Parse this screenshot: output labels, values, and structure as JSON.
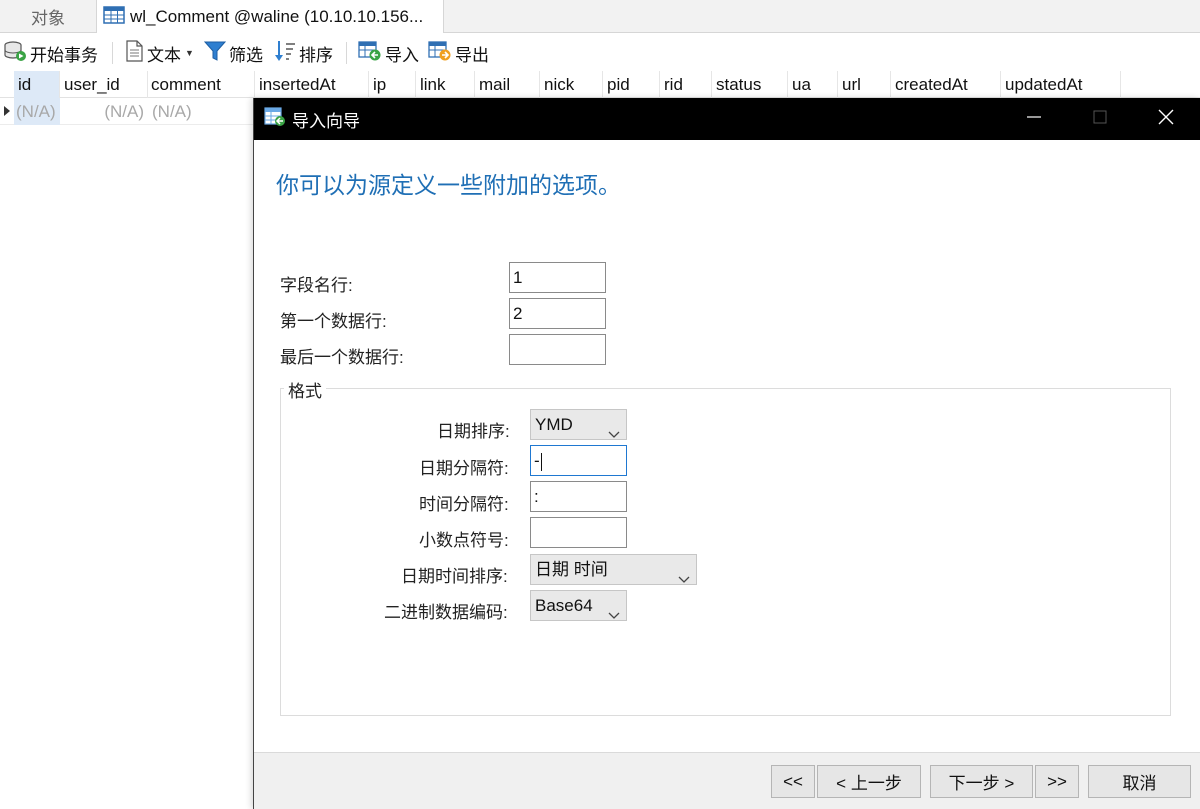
{
  "tabs": {
    "objects_label": "对象",
    "table_label": "wl_Comment @waline (10.10.10.156..."
  },
  "toolbar": {
    "begin_transaction": "开始事务",
    "text": "文本",
    "filter": "筛选",
    "sort": "排序",
    "import": "导入",
    "export": "导出"
  },
  "grid": {
    "columns": [
      "id",
      "user_id",
      "comment",
      "insertedAt",
      "ip",
      "link",
      "mail",
      "nick",
      "pid",
      "rid",
      "status",
      "ua",
      "url",
      "createdAt",
      "updatedAt"
    ],
    "row": [
      "(N/A)",
      "(N/A)",
      "(N/A)"
    ]
  },
  "dialog": {
    "title": "导入向导",
    "heading": "你可以为源定义一些附加的选项。",
    "field_name_row": {
      "label": "字段名行:",
      "value": "1"
    },
    "first_data_row": {
      "label": "第一个数据行:",
      "value": "2"
    },
    "last_data_row": {
      "label": "最后一个数据行:",
      "value": ""
    },
    "format_group": "格式",
    "date_order": {
      "label": "日期排序:",
      "value": "YMD"
    },
    "date_delimiter": {
      "label": "日期分隔符:",
      "value": "-"
    },
    "time_delimiter": {
      "label": "时间分隔符:",
      "value": ":"
    },
    "decimal_symbol": {
      "label": "小数点符号:",
      "value": ""
    },
    "datetime_order": {
      "label": "日期时间排序:",
      "value": "日期 时间"
    },
    "binary_encoding": {
      "label": "二进制数据编码:",
      "value": "Base64"
    },
    "buttons": {
      "first": "<<",
      "prev": "< 上一步",
      "next": "下一步 >",
      "last": ">>",
      "cancel": "取消"
    }
  },
  "colors": {
    "heading": "#1f6fb5",
    "titlebar": "#000000",
    "focus_border": "#1f78d1",
    "selected_cell": "#dde9f7"
  }
}
